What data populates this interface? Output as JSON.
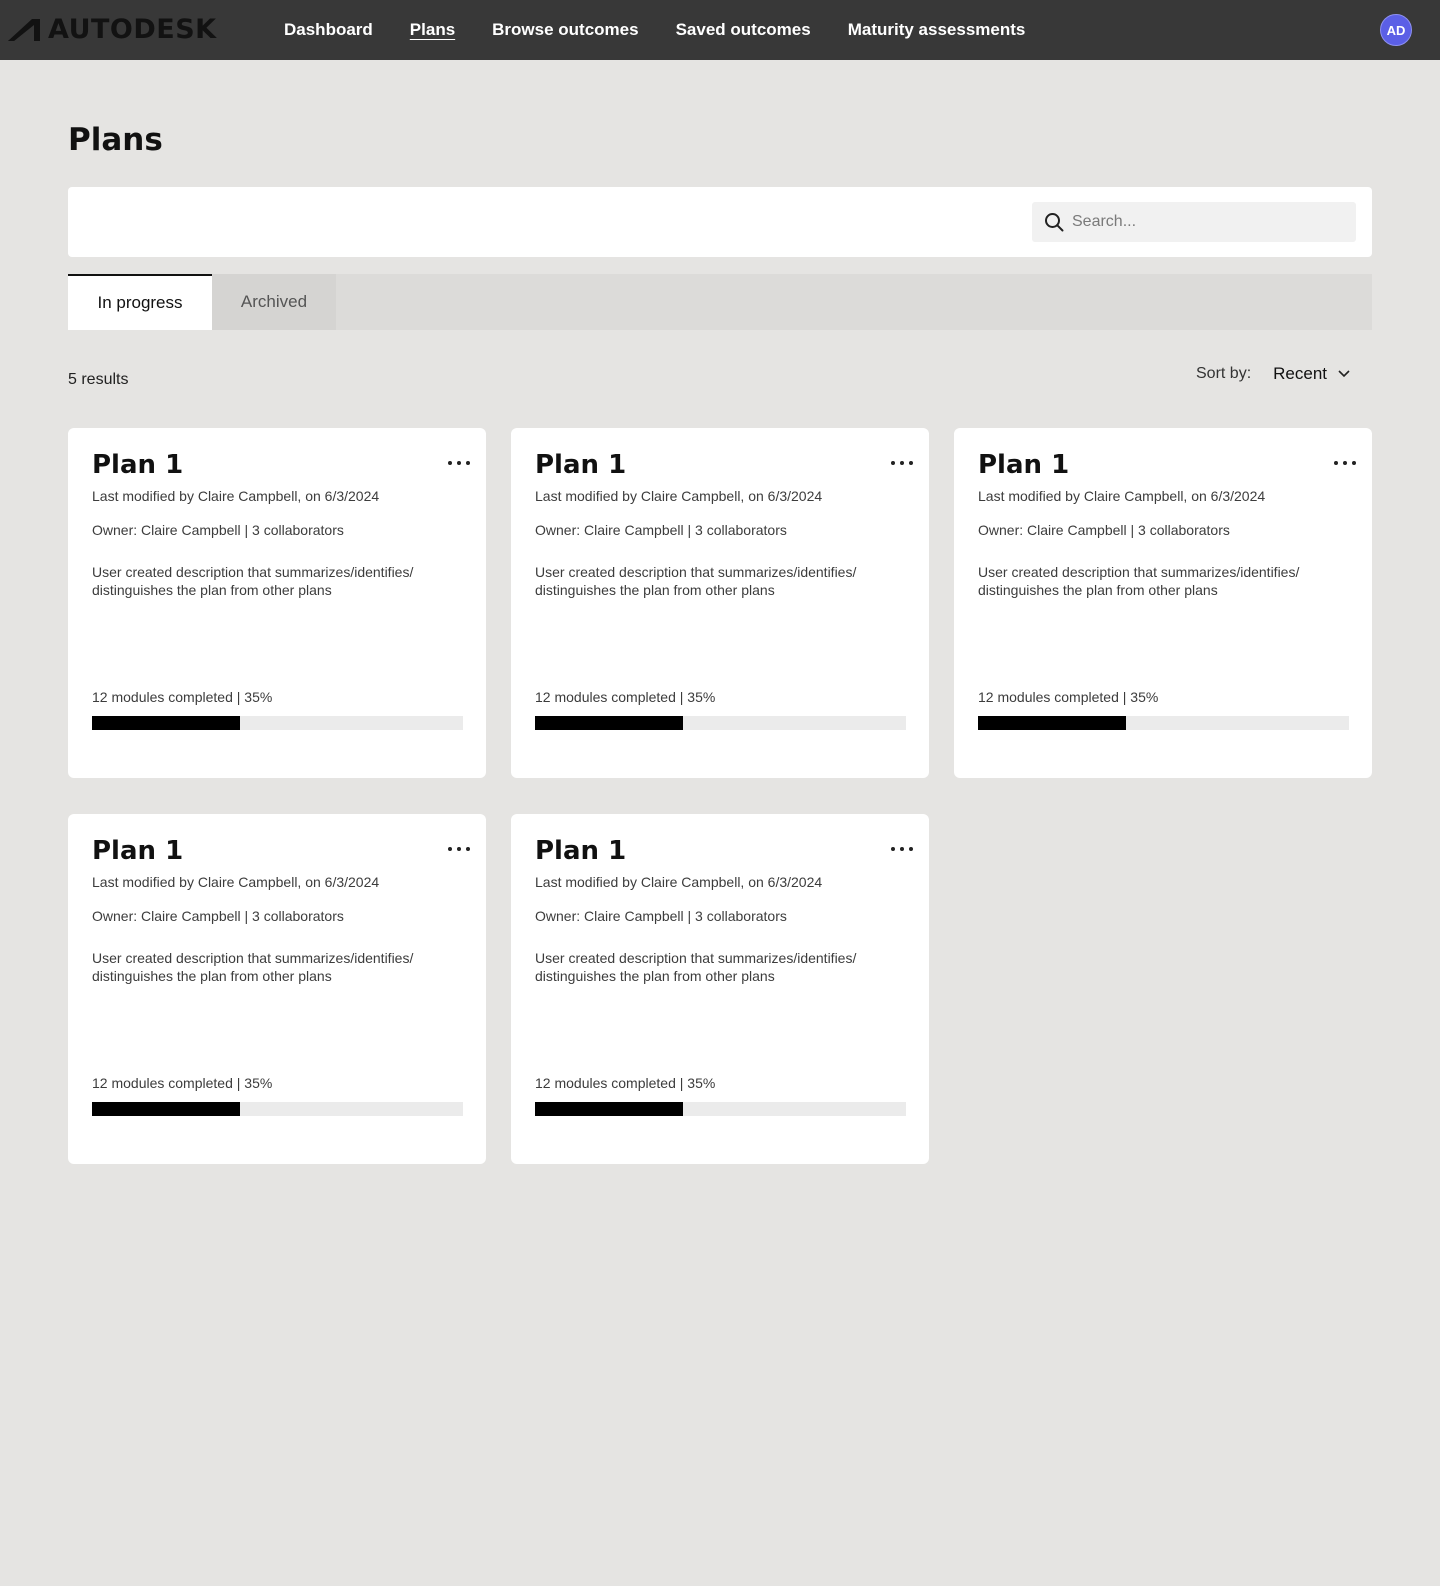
{
  "brand": {
    "name": "AUTODESK",
    "logo_icon": "autodesk-logo-icon"
  },
  "nav": {
    "items": [
      {
        "label": "Dashboard",
        "active": false
      },
      {
        "label": "Plans",
        "active": true
      },
      {
        "label": "Browse outcomes",
        "active": false
      },
      {
        "label": "Saved outcomes",
        "active": false
      },
      {
        "label": "Maturity assessments",
        "active": false
      }
    ],
    "avatar_initials": "AD",
    "avatar_color": "#5b5fe6"
  },
  "page": {
    "title": "Plans"
  },
  "search": {
    "placeholder": "Search...",
    "icon": "search-icon"
  },
  "tabs": [
    {
      "label": "In progress",
      "active": true
    },
    {
      "label": "Archived",
      "active": false
    }
  ],
  "results": {
    "count_text": "5 results"
  },
  "sort": {
    "label": "Sort by:",
    "value": "Recent",
    "icon": "chevron-down-icon"
  },
  "cards": [
    {
      "title": "Plan 1",
      "modified": "Last modified by Claire Campbell, on 6/3/2024",
      "owner": "Owner: Claire Campbell | 3 collaborators",
      "description": "User created description that summarizes/identifies/ distinguishes the plan from other plans",
      "progress_text": "12 modules completed | 35%",
      "progress_fraction": 0.4
    },
    {
      "title": "Plan 1",
      "modified": "Last modified by Claire Campbell, on 6/3/2024",
      "owner": "Owner: Claire Campbell | 3 collaborators",
      "description": "User created description that summarizes/identifies/ distinguishes the plan from other plans",
      "progress_text": "12 modules completed | 35%",
      "progress_fraction": 0.4
    },
    {
      "title": "Plan 1",
      "modified": "Last modified by Claire Campbell, on 6/3/2024",
      "owner": "Owner: Claire Campbell | 3 collaborators",
      "description": "User created description that summarizes/identifies/ distinguishes the plan from other plans",
      "progress_text": "12 modules completed | 35%",
      "progress_fraction": 0.4
    },
    {
      "title": "Plan 1",
      "modified": "Last modified by Claire Campbell, on 6/3/2024",
      "owner": "Owner: Claire Campbell | 3 collaborators",
      "description": "User created description that summarizes/identifies/ distinguishes the plan from other plans",
      "progress_text": "12 modules completed | 35%",
      "progress_fraction": 0.4
    },
    {
      "title": "Plan 1",
      "modified": "Last modified by Claire Campbell, on 6/3/2024",
      "owner": "Owner: Claire Campbell | 3 collaborators",
      "description": "User created description that summarizes/identifies/ distinguishes the plan from other plans",
      "progress_text": "12 modules completed | 35%",
      "progress_fraction": 0.4
    }
  ]
}
